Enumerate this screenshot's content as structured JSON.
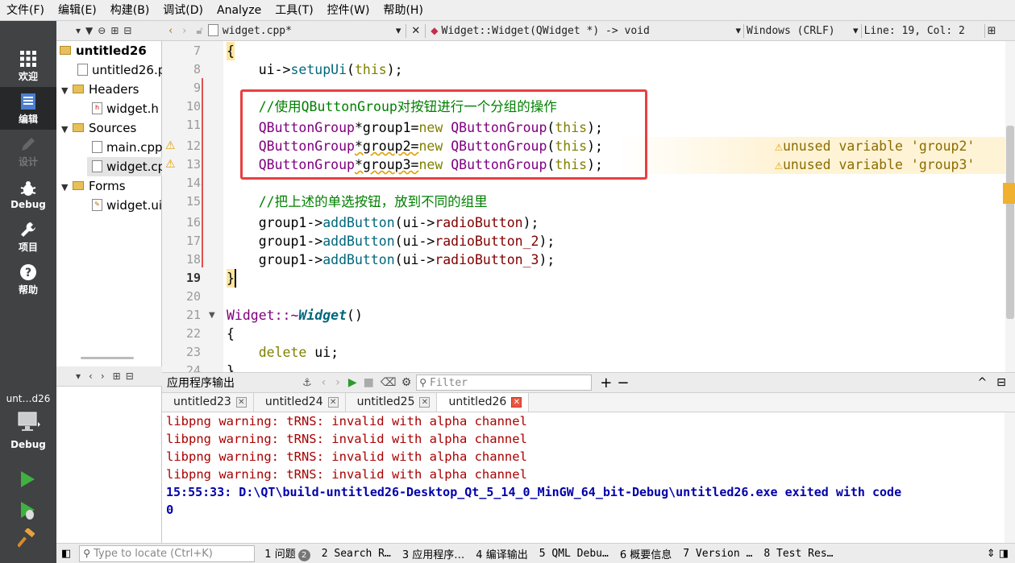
{
  "menu": [
    "文件(F)",
    "编辑(E)",
    "构建(B)",
    "调试(D)",
    "Analyze",
    "工具(T)",
    "控件(W)",
    "帮助(H)"
  ],
  "modes": [
    {
      "label": "欢迎",
      "icon": "grid-icon"
    },
    {
      "label": "编辑",
      "icon": "document-icon"
    },
    {
      "label": "设计",
      "icon": "pencil-icon"
    },
    {
      "label": "Debug",
      "icon": "bug-icon"
    },
    {
      "label": "项目",
      "icon": "wrench-icon"
    },
    {
      "label": "帮助",
      "icon": "help-icon"
    }
  ],
  "kit": {
    "project": "unt…d26",
    "build": "Debug"
  },
  "tree": {
    "project": "untitled26",
    "pro_file": "untitled26.p",
    "headers": "Headers",
    "header_file": "widget.h",
    "sources": "Sources",
    "main_file": "main.cpp",
    "widget_cpp": "widget.cp",
    "forms": "Forms",
    "ui_file": "widget.ui"
  },
  "editor_bar": {
    "file": "widget.cpp*",
    "symbol": "Widget::Widget(QWidget *) -> void",
    "line_ending": "Windows (CRLF)",
    "position": "Line: 19, Col: 2"
  },
  "lines": {
    "n7": "7",
    "n8": "8",
    "n9": "9",
    "n10": "10",
    "n11": "11",
    "n12": "12",
    "n13": "13",
    "n14": "14",
    "n15": "15",
    "n16": "16",
    "n17": "17",
    "n18": "18",
    "n19": "19",
    "n20": "20",
    "n21": "21",
    "n22": "22",
    "n23": "23",
    "n24": "24"
  },
  "code": {
    "l7": "{",
    "l8_a": "    ui->",
    "l8_fn": "setupUi",
    "l8_b": "(",
    "l8_kw": "this",
    "l8_c": ");",
    "l10": "    //使用QButtonGroup对按钮进行一个分组的操作",
    "g_type": "QButtonGroup",
    "g1": "*group1=",
    "g2": "*group2=",
    "g3": "*group3=",
    "new_kw": "new",
    "paren_open": "(",
    "this_kw": "this",
    "paren_close": ");",
    "l15": "    //把上述的单选按钮，放到不同的组里",
    "indent": "    ",
    "add_prefix": "group1->",
    "add_fn": "addButton",
    "ui_prefix": "(ui->",
    "rb1": "radioButton",
    "rb2": "radioButton_2",
    "rb3": "radioButton_3",
    "close": ");",
    "l19": "}",
    "l21_a": "Widget::~",
    "l21_fn": "Widget",
    "l21_b": "()",
    "l22": "{",
    "l23_kw": "delete",
    "l23_b": " ui;",
    "l24": "}"
  },
  "warnings": {
    "w12": "unused variable 'group2'",
    "w13": "unused variable 'group3'"
  },
  "output": {
    "title": "应用程序输出",
    "filter_placeholder": "Filter",
    "tabs": [
      "untitled23",
      "untitled24",
      "untitled25",
      "untitled26"
    ],
    "lines": [
      "libpng warning: tRNS: invalid with alpha channel",
      "libpng warning: tRNS: invalid with alpha channel",
      "libpng warning: tRNS: invalid with alpha channel",
      "libpng warning: tRNS: invalid with alpha channel"
    ],
    "exit_line1": "15:55:33: D:\\QT\\build-untitled26-Desktop_Qt_5_14_0_MinGW_64_bit-Debug\\untitled26.exe exited with code",
    "exit_line2": "0"
  },
  "status": {
    "locate_placeholder": "Type to locate (Ctrl+K)",
    "items": [
      {
        "num": "1",
        "label": "问题",
        "badge": "2"
      },
      {
        "num": "2",
        "label": "Search R…"
      },
      {
        "num": "3",
        "label": "应用程序…"
      },
      {
        "num": "4",
        "label": "编译输出"
      },
      {
        "num": "5",
        "label": "QML Debu…"
      },
      {
        "num": "6",
        "label": "概要信息"
      },
      {
        "num": "7",
        "label": "Version …"
      },
      {
        "num": "8",
        "label": "Test Res…"
      }
    ]
  },
  "colors": {
    "accent_red": "#e84040",
    "warning": "#e0a000",
    "mode_bg": "#404244"
  }
}
